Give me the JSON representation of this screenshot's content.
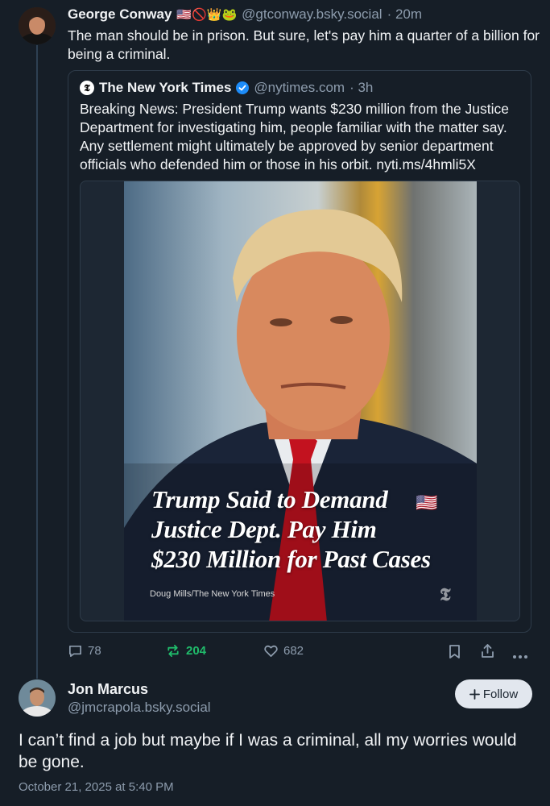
{
  "post": {
    "author_name": "George Conway",
    "author_emojis": "🇺🇸🚫👑🐸",
    "handle": "@gtconway.bsky.social",
    "time": "· 20m",
    "text": "The man should be in prison.  But sure, let's pay him a quarter of a billion for being a criminal."
  },
  "quote": {
    "source_name": "The New York Times",
    "handle": "@nytimes.com",
    "time": "· 3h",
    "text": "Breaking News: President Trump wants $230 million from the Justice Department for investigating him, people familiar with the matter say. Any settlement might ultimately be approved by senior department officials who defended him or those in his orbit. nyti.ms/4hmli5X",
    "image": {
      "headline_line1": "Trump Said to Demand",
      "headline_line2": "Justice Dept. Pay Him",
      "headline_line3": "$230 Million for Past Cases",
      "credit": "Doug Mills/The New York Times",
      "flag": "🇺🇸"
    }
  },
  "actions": {
    "replies": "78",
    "reposts": "204",
    "likes": "682"
  },
  "reply": {
    "author_name": "Jon Marcus",
    "handle": "@jmcrapola.bsky.social",
    "follow_label": "Follow",
    "text": "I can’t find a job but maybe if I was a criminal, all my worries would be gone.",
    "timestamp": "October 21, 2025 at 5:40 PM"
  },
  "colors": {
    "background": "#161e27",
    "muted": "#8d9cad",
    "repost_active": "#20bc6b",
    "verified": "#1d8cf8"
  }
}
